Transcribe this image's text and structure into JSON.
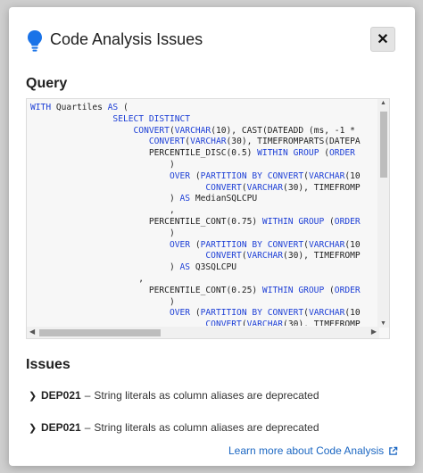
{
  "dialog": {
    "title": "Code Analysis Issues",
    "close_label": "✕"
  },
  "query": {
    "heading": "Query",
    "lines": [
      [
        {
          "t": "WITH",
          "k": 1
        },
        {
          "t": " Quartiles "
        },
        {
          "t": "AS",
          "k": 1
        },
        {
          "t": " ("
        }
      ],
      [
        {
          "t": "                SELECT DISTINCT",
          "k": 1
        }
      ],
      [
        {
          "t": "                    "
        },
        {
          "t": "CONVERT",
          "k": 1
        },
        {
          "t": "("
        },
        {
          "t": "VARCHAR",
          "k": 1
        },
        {
          "t": "(10), CAST(DATEADD (ms, -1 * "
        }
      ],
      [
        {
          "t": "                       "
        },
        {
          "t": "CONVERT",
          "k": 1
        },
        {
          "t": "("
        },
        {
          "t": "VARCHAR",
          "k": 1
        },
        {
          "t": "(30), TIMEFROMPARTS(DATEPA"
        }
      ],
      [
        {
          "t": "                       PERCENTILE_DISC(0.5) "
        },
        {
          "t": "WITHIN GROUP",
          "k": 1
        },
        {
          "t": " ("
        },
        {
          "t": "ORDER",
          "k": 1
        }
      ],
      [
        {
          "t": "                           )"
        }
      ],
      [
        {
          "t": "                           "
        },
        {
          "t": "OVER",
          "k": 1
        },
        {
          "t": " ("
        },
        {
          "t": "PARTITION BY",
          "k": 1
        },
        {
          "t": " "
        },
        {
          "t": "CONVERT",
          "k": 1
        },
        {
          "t": "("
        },
        {
          "t": "VARCHAR",
          "k": 1
        },
        {
          "t": "(10"
        }
      ],
      [
        {
          "t": "                                  "
        },
        {
          "t": "CONVERT",
          "k": 1
        },
        {
          "t": "("
        },
        {
          "t": "VARCHAR",
          "k": 1
        },
        {
          "t": "(30), TIMEFROMP"
        }
      ],
      [
        {
          "t": "                           ) "
        },
        {
          "t": "AS",
          "k": 1
        },
        {
          "t": " MedianSQLCPU"
        }
      ],
      [
        {
          "t": "                           ,"
        }
      ],
      [
        {
          "t": "                       PERCENTILE_CONT(0.75) "
        },
        {
          "t": "WITHIN GROUP",
          "k": 1
        },
        {
          "t": " ("
        },
        {
          "t": "ORDER",
          "k": 1
        }
      ],
      [
        {
          "t": "                           )"
        }
      ],
      [
        {
          "t": "                           "
        },
        {
          "t": "OVER",
          "k": 1
        },
        {
          "t": " ("
        },
        {
          "t": "PARTITION BY",
          "k": 1
        },
        {
          "t": " "
        },
        {
          "t": "CONVERT",
          "k": 1
        },
        {
          "t": "("
        },
        {
          "t": "VARCHAR",
          "k": 1
        },
        {
          "t": "(10"
        }
      ],
      [
        {
          "t": "                                  "
        },
        {
          "t": "CONVERT",
          "k": 1
        },
        {
          "t": "("
        },
        {
          "t": "VARCHAR",
          "k": 1
        },
        {
          "t": "(30), TIMEFROMP"
        }
      ],
      [
        {
          "t": "                           ) "
        },
        {
          "t": "AS",
          "k": 1
        },
        {
          "t": " Q3SQLCPU"
        }
      ],
      [
        {
          "t": "                     ,"
        }
      ],
      [
        {
          "t": "                       PERCENTILE_CONT(0.25) "
        },
        {
          "t": "WITHIN GROUP",
          "k": 1
        },
        {
          "t": " ("
        },
        {
          "t": "ORDER",
          "k": 1
        }
      ],
      [
        {
          "t": "                           )"
        }
      ],
      [
        {
          "t": "                           "
        },
        {
          "t": "OVER",
          "k": 1
        },
        {
          "t": " ("
        },
        {
          "t": "PARTITION BY",
          "k": 1
        },
        {
          "t": " "
        },
        {
          "t": "CONVERT",
          "k": 1
        },
        {
          "t": "("
        },
        {
          "t": "VARCHAR",
          "k": 1
        },
        {
          "t": "(10"
        }
      ],
      [
        {
          "t": "                                  "
        },
        {
          "t": "CONVERT",
          "k": 1
        },
        {
          "t": "("
        },
        {
          "t": "VARCHAR",
          "k": 1
        },
        {
          "t": "(30), TIMEFROMP"
        }
      ]
    ]
  },
  "issues": {
    "heading": "Issues",
    "items": [
      {
        "code": "DEP021",
        "separator": "–",
        "message": "String literals as column aliases are deprecated"
      },
      {
        "code": "DEP021",
        "separator": "–",
        "message": "String literals as column aliases are deprecated"
      }
    ]
  },
  "footer": {
    "link_label": "Learn more about Code Analysis"
  },
  "colors": {
    "keyword": "#1d3fd6",
    "link": "#1a66c2",
    "bulb": "#1a73e8"
  },
  "icons": [
    "lightbulb-icon",
    "close-icon",
    "chevron-right-icon",
    "external-link-icon"
  ]
}
